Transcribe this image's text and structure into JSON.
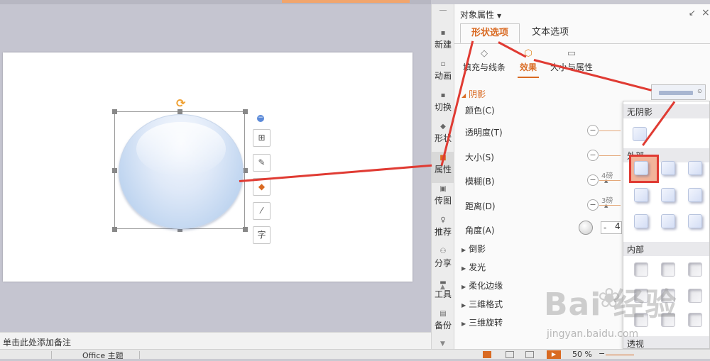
{
  "rail": {
    "items": [
      {
        "label": "新建",
        "icon": "new-icon"
      },
      {
        "label": "动画",
        "icon": "animation-icon"
      },
      {
        "label": "切换",
        "icon": "transition-icon"
      },
      {
        "label": "形状",
        "icon": "shape-icon"
      },
      {
        "label": "属性",
        "icon": "property-icon",
        "active": true
      },
      {
        "label": "传图",
        "icon": "image-icon"
      },
      {
        "label": "推荐",
        "icon": "recommend-icon"
      },
      {
        "label": "分享",
        "icon": "share-icon"
      },
      {
        "label": "工具",
        "icon": "toolbox-icon"
      },
      {
        "label": "备份",
        "icon": "backup-icon"
      }
    ]
  },
  "panel": {
    "title": "对象属性",
    "tabs": [
      "形状选项",
      "文本选项"
    ],
    "sub_tabs": [
      "填充与线条",
      "效果",
      "大小与属性"
    ],
    "shadow_section": "阴影",
    "props": {
      "color": "颜色(C)",
      "transparency": "透明度(T)",
      "size": "大小(S)",
      "blur": "模糊(B)",
      "distance": "距离(D)",
      "angle": "角度(A)"
    },
    "blur_value": "4磅",
    "distance_value": "3磅",
    "angle_value": "-",
    "angle_value2": "4",
    "collapsed_sections": [
      "倒影",
      "发光",
      "柔化边缘",
      "三维格式",
      "三维旋转"
    ]
  },
  "dropdown": {
    "no_shadow": "无阴影",
    "outer": "外部",
    "inner": "内部",
    "perspective": "透视"
  },
  "notes_placeholder": "单击此处添加备注",
  "status": {
    "theme": "Office 主题",
    "zoom": "50 %",
    "zoom_minus": "−"
  },
  "watermark": {
    "text": "Bai  经验",
    "url": "jingyan.baidu.com"
  },
  "colors": {
    "accent": "#d96a22",
    "annotation": "#e03b33"
  }
}
